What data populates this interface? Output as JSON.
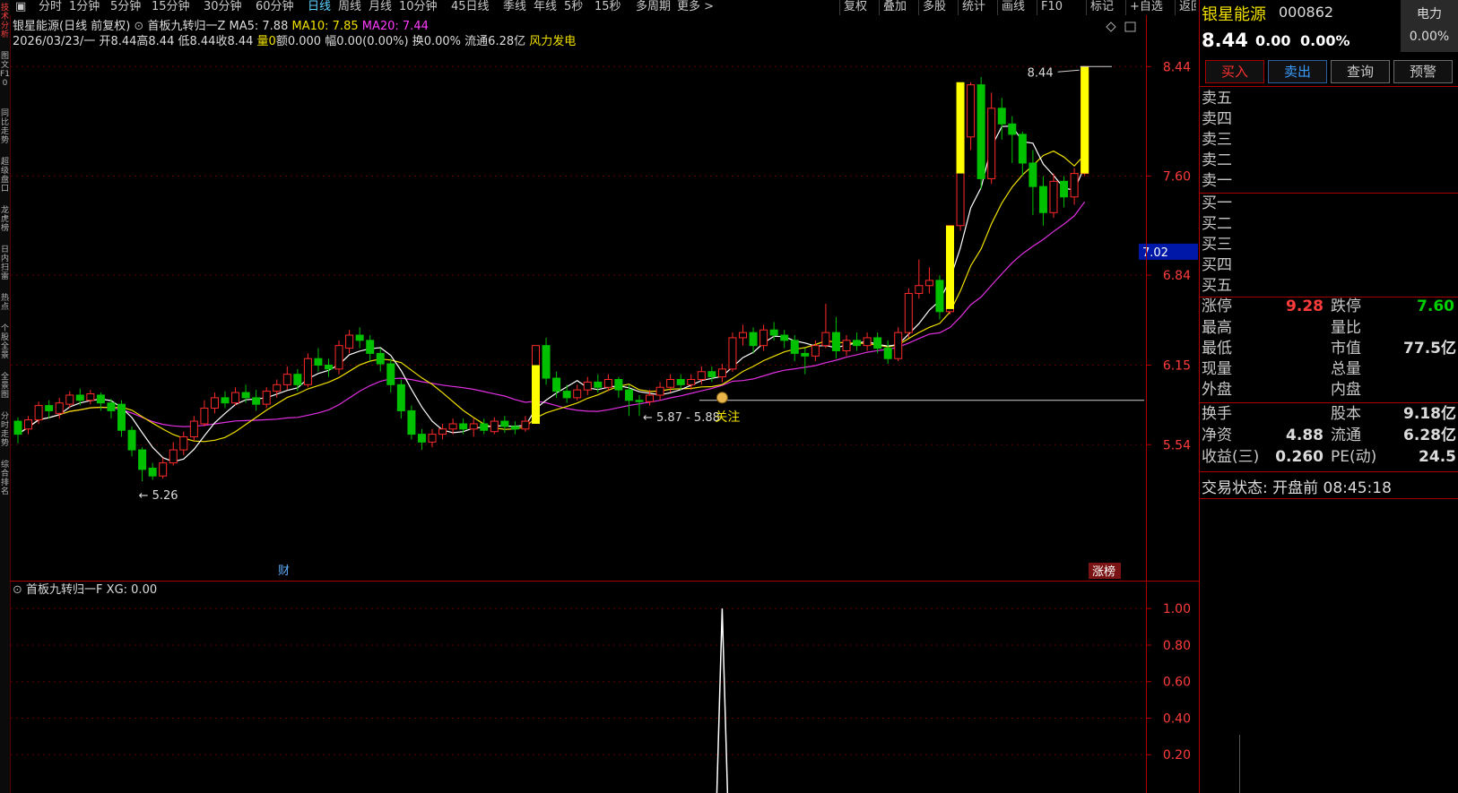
{
  "toolbar": {
    "left_tabs": [
      "分时",
      "1分钟",
      "5分钟",
      "15分钟",
      "30分钟",
      "60分钟",
      "日线",
      "周线",
      "月线",
      "10分钟",
      "45日线",
      "季线",
      "年线",
      "5秒",
      "15秒",
      "多周期",
      "更多 >"
    ],
    "active_tab": "日线",
    "right_tabs": [
      "复权",
      "叠加",
      "多股",
      "统计",
      "画线",
      "F10",
      "标记",
      "+自选",
      "返回"
    ]
  },
  "left_strip": [
    "技术分析",
    "图文F10",
    "同比走势",
    "超级盘口",
    "龙虎榜",
    "日内扫雷",
    "热点",
    "个股全景",
    "全景图",
    "分时走势",
    "综合排名"
  ],
  "chart_header": {
    "title": "银星能源(日线 前复权)",
    "indicator_name": "首板九转归一Z",
    "ma5": "MA5: 7.88",
    "ma10": "MA10: 7.85",
    "ma20": "MA20: 7.44",
    "date": "2026/03/23/一",
    "open": "开8.44",
    "high": "高8.44",
    "low": "低8.44",
    "close": "收8.44",
    "volume": "量0",
    "amount": "额0.000",
    "change": "幅0.00(0.00%)",
    "turnover": "换0.00%",
    "float_cap": "流通6.28亿",
    "sector": "风力发电"
  },
  "annotations": {
    "high_label": "8.44",
    "low_label": "5.26",
    "range_label": "5.87 - 5.88",
    "watch_label": "关注",
    "cai_label": "财",
    "zhangbang_label": "涨榜",
    "current_price_tag": "7.02"
  },
  "sub_header": {
    "name": "首板九转归一F",
    "xg": "XG: 0.00"
  },
  "colors": {
    "up": "#ff2a2a",
    "down": "#00c000",
    "ma5": "#ffffff",
    "ma10": "#f0e000",
    "ma20": "#e030e0",
    "axis_red": "#aa0000",
    "signal_yellow": "#ffff00"
  },
  "chart_data": {
    "type": "candlestick",
    "y_ticks": [
      8.44,
      7.6,
      6.84,
      6.15,
      5.54
    ],
    "ylim": [
      5.15,
      8.6
    ],
    "current_price_marker": 7.02,
    "watch_level": 5.88,
    "candles": [
      [
        5.72,
        5.62,
        5.75,
        5.55
      ],
      [
        5.66,
        5.73,
        5.76,
        5.62
      ],
      [
        5.73,
        5.84,
        5.87,
        5.7
      ],
      [
        5.84,
        5.8,
        5.88,
        5.74
      ],
      [
        5.78,
        5.86,
        5.9,
        5.74
      ],
      [
        5.85,
        5.92,
        5.95,
        5.82
      ],
      [
        5.92,
        5.88,
        5.97,
        5.84
      ],
      [
        5.88,
        5.93,
        5.96,
        5.85
      ],
      [
        5.92,
        5.86,
        5.94,
        5.8
      ],
      [
        5.86,
        5.8,
        5.89,
        5.74
      ],
      [
        5.85,
        5.65,
        5.88,
        5.6
      ],
      [
        5.65,
        5.5,
        5.68,
        5.45
      ],
      [
        5.5,
        5.35,
        5.52,
        5.26
      ],
      [
        5.36,
        5.3,
        5.4,
        5.27
      ],
      [
        5.3,
        5.4,
        5.44,
        5.28
      ],
      [
        5.4,
        5.5,
        5.56,
        5.38
      ],
      [
        5.5,
        5.6,
        5.64,
        5.46
      ],
      [
        5.6,
        5.72,
        5.76,
        5.57
      ],
      [
        5.7,
        5.82,
        5.88,
        5.68
      ],
      [
        5.82,
        5.9,
        5.94,
        5.78
      ],
      [
        5.9,
        5.86,
        5.95,
        5.82
      ],
      [
        5.86,
        5.94,
        5.98,
        5.84
      ],
      [
        5.94,
        5.9,
        6.0,
        5.86
      ],
      [
        5.9,
        5.85,
        5.96,
        5.8
      ],
      [
        5.85,
        5.95,
        5.98,
        5.82
      ],
      [
        5.95,
        6.0,
        6.04,
        5.9
      ],
      [
        6.0,
        6.08,
        6.14,
        5.96
      ],
      [
        6.08,
        6.0,
        6.12,
        5.95
      ],
      [
        6.0,
        6.2,
        6.24,
        5.98
      ],
      [
        6.2,
        6.15,
        6.28,
        6.1
      ],
      [
        6.15,
        6.12,
        6.2,
        6.06
      ],
      [
        6.12,
        6.3,
        6.34,
        6.08
      ],
      [
        6.28,
        6.38,
        6.42,
        6.24
      ],
      [
        6.38,
        6.34,
        6.44,
        6.28
      ],
      [
        6.34,
        6.24,
        6.38,
        6.18
      ],
      [
        6.24,
        6.16,
        6.28,
        6.1
      ],
      [
        6.16,
        6.0,
        6.2,
        5.94
      ],
      [
        6.0,
        5.8,
        6.04,
        5.74
      ],
      [
        5.8,
        5.62,
        5.84,
        5.58
      ],
      [
        5.62,
        5.56,
        5.66,
        5.5
      ],
      [
        5.56,
        5.62,
        5.66,
        5.52
      ],
      [
        5.62,
        5.66,
        5.7,
        5.58
      ],
      [
        5.66,
        5.7,
        5.74,
        5.62
      ],
      [
        5.7,
        5.66,
        5.74,
        5.62
      ],
      [
        5.66,
        5.7,
        5.74,
        5.6
      ],
      [
        5.7,
        5.65,
        5.74,
        5.62
      ],
      [
        5.64,
        5.72,
        5.75,
        5.62
      ],
      [
        5.72,
        5.68,
        5.76,
        5.63
      ],
      [
        5.68,
        5.66,
        5.72,
        5.62
      ],
      [
        5.66,
        5.72,
        5.76,
        5.64
      ],
      [
        5.72,
        6.3,
        6.3,
        5.7
      ],
      [
        6.3,
        6.05,
        6.36,
        6.0
      ],
      [
        6.05,
        5.95,
        6.1,
        5.9
      ],
      [
        5.95,
        5.9,
        6.0,
        5.86
      ],
      [
        5.9,
        5.96,
        6.0,
        5.88
      ],
      [
        5.96,
        6.02,
        6.06,
        5.92
      ],
      [
        6.02,
        5.98,
        6.08,
        5.94
      ],
      [
        5.98,
        6.04,
        6.08,
        5.95
      ],
      [
        6.04,
        5.96,
        6.06,
        5.9
      ],
      [
        5.96,
        5.88,
        6.0,
        5.76
      ],
      [
        5.88,
        5.87,
        5.92,
        5.76
      ],
      [
        5.87,
        5.92,
        5.96,
        5.84
      ],
      [
        5.92,
        5.98,
        6.02,
        5.88
      ],
      [
        5.98,
        6.04,
        6.08,
        5.94
      ],
      [
        6.04,
        6.0,
        6.08,
        5.96
      ],
      [
        6.0,
        6.04,
        6.08,
        5.96
      ],
      [
        6.04,
        6.1,
        6.14,
        6.0
      ],
      [
        6.1,
        6.06,
        6.14,
        6.02
      ],
      [
        6.06,
        6.12,
        6.16,
        6.02
      ],
      [
        6.12,
        6.36,
        6.4,
        6.1
      ],
      [
        6.36,
        6.4,
        6.46,
        6.3
      ],
      [
        6.4,
        6.3,
        6.44,
        6.24
      ],
      [
        6.3,
        6.42,
        6.46,
        6.26
      ],
      [
        6.42,
        6.38,
        6.48,
        6.34
      ],
      [
        6.38,
        6.34,
        6.42,
        6.28
      ],
      [
        6.34,
        6.24,
        6.38,
        6.18
      ],
      [
        6.24,
        6.22,
        6.28,
        6.08
      ],
      [
        6.22,
        6.3,
        6.34,
        6.18
      ],
      [
        6.3,
        6.4,
        6.62,
        6.28
      ],
      [
        6.4,
        6.26,
        6.52,
        6.2
      ],
      [
        6.26,
        6.34,
        6.38,
        6.22
      ],
      [
        6.34,
        6.3,
        6.4,
        6.26
      ],
      [
        6.3,
        6.36,
        6.4,
        6.26
      ],
      [
        6.36,
        6.28,
        6.4,
        6.24
      ],
      [
        6.28,
        6.2,
        6.34,
        6.16
      ],
      [
        6.2,
        6.4,
        6.44,
        6.18
      ],
      [
        6.4,
        6.7,
        6.74,
        6.36
      ],
      [
        6.7,
        6.76,
        6.96,
        6.66
      ],
      [
        6.76,
        6.8,
        6.9,
        6.7
      ],
      [
        6.8,
        6.56,
        6.84,
        6.5
      ],
      [
        6.56,
        7.22,
        7.22,
        6.54
      ],
      [
        7.22,
        7.9,
        7.94,
        7.18
      ],
      [
        7.9,
        8.3,
        8.32,
        7.8
      ],
      [
        8.3,
        7.58,
        8.36,
        7.5
      ],
      [
        7.58,
        8.12,
        8.24,
        7.54
      ],
      [
        8.12,
        8.0,
        8.2,
        7.88
      ],
      [
        8.0,
        7.92,
        8.06,
        7.7
      ],
      [
        7.92,
        7.7,
        7.94,
        7.6
      ],
      [
        7.7,
        7.52,
        7.8,
        7.3
      ],
      [
        7.52,
        7.32,
        7.6,
        7.22
      ],
      [
        7.32,
        7.56,
        7.62,
        7.28
      ],
      [
        7.56,
        7.44,
        7.6,
        7.36
      ],
      [
        7.44,
        7.62,
        7.66,
        7.38
      ],
      [
        7.62,
        8.44,
        8.44,
        7.6
      ]
    ],
    "signals": [
      {
        "index": 50,
        "low": 5.7,
        "high": 6.15
      },
      {
        "index": 90,
        "low": 6.58,
        "high": 7.22
      },
      {
        "index": 91,
        "low": 7.62,
        "high": 8.32
      },
      {
        "index": 103,
        "low": 7.62,
        "high": 8.44
      }
    ],
    "sub": {
      "y_ticks": [
        1.0,
        0.8,
        0.6,
        0.4,
        0.2
      ],
      "ylim": [
        0,
        1.05
      ],
      "spike_index": 68,
      "spike_value": 1.0
    }
  },
  "right_panel": {
    "name": "银星能源",
    "code": "000862",
    "corner_label": "电力",
    "corner_pct": "0.00%",
    "price": "8.44",
    "change": "0.00",
    "change_pct": "0.00%",
    "buttons": [
      "买入",
      "卖出",
      "查询",
      "预警"
    ],
    "sell_levels": [
      "卖五",
      "卖四",
      "卖三",
      "卖二",
      "卖一"
    ],
    "buy_levels": [
      "买一",
      "买二",
      "买三",
      "买四",
      "买五"
    ],
    "limit_up_label": "涨停",
    "limit_up": "9.28",
    "limit_down_label": "跌停",
    "limit_down": "7.60",
    "high_label": "最高",
    "vol_ratio_label": "量比",
    "low_label": "最低",
    "mktcap_label": "市值",
    "mktcap": "77.5亿",
    "cur_vol_label": "现量",
    "total_vol_label": "总量",
    "outer_label": "外盘",
    "inner_label": "内盘",
    "turnover_label": "换手",
    "shares_label": "股本",
    "shares": "9.18亿",
    "nav_label": "净资",
    "nav": "4.88",
    "float_label": "流通",
    "float": "6.28亿",
    "eps_label": "收益(三)",
    "eps": "0.260",
    "pe_label": "PE(动)",
    "pe": "24.5",
    "trade_status": "交易状态: 开盘前 08:45:18"
  }
}
